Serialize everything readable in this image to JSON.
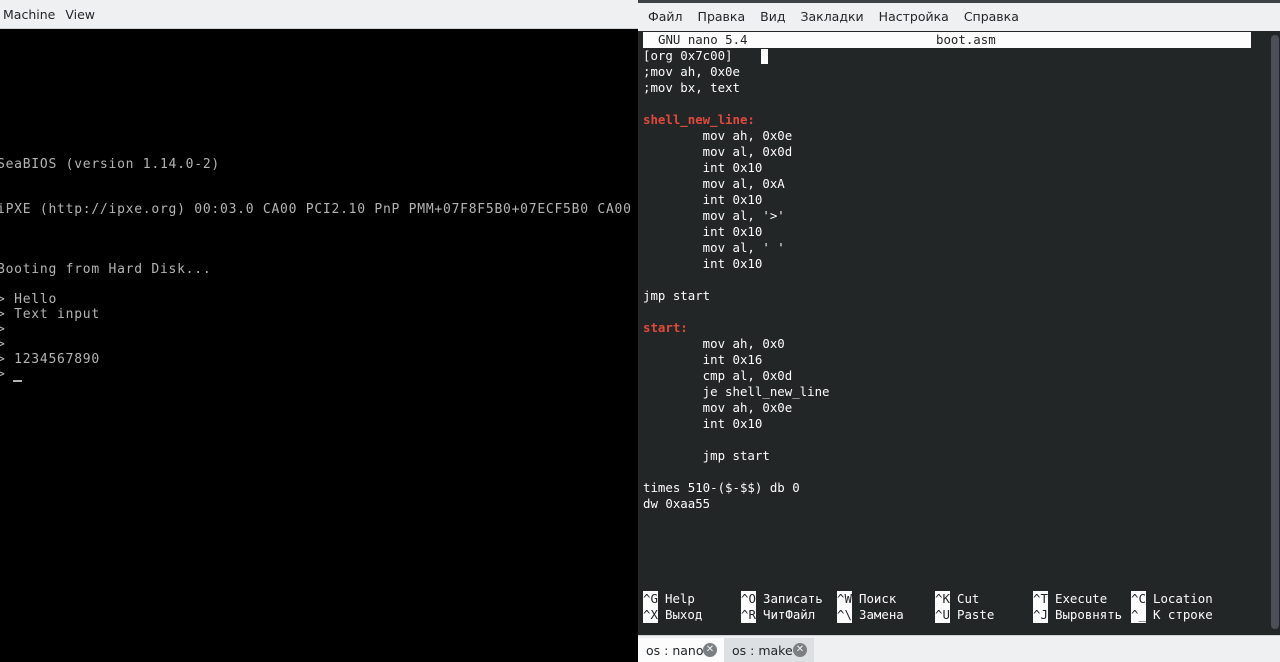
{
  "qemu": {
    "menu": [
      "Machine",
      "View"
    ],
    "screen_lines": [
      "SeaBIOS (version 1.14.0-2)",
      "iPXE (http://ipxe.org) 00:03.0 CA00 PCI2.10 PnP PMM+07F8F5B0+07ECF5B0 CA00",
      "Booting from Hard Disk...",
      "> Hello",
      "> Text input",
      ">",
      ">",
      "> 1234567890",
      ">"
    ]
  },
  "konsole": {
    "menu": [
      "Файл",
      "Правка",
      "Вид",
      "Закладки",
      "Настройка",
      "Справка"
    ],
    "nano": {
      "version": "GNU nano 5.4",
      "filename": "boot.asm",
      "lines": [
        {
          "text": "[org 0x7c00]",
          "label": false
        },
        {
          "text": ";mov ah, 0x0e",
          "label": false
        },
        {
          "text": ";mov bx, text",
          "label": false
        },
        {
          "text": "",
          "label": false
        },
        {
          "text": "shell_new_line:",
          "label": true
        },
        {
          "text": "        mov ah, 0x0e",
          "label": false
        },
        {
          "text": "        mov al, 0x0d",
          "label": false
        },
        {
          "text": "        int 0x10",
          "label": false
        },
        {
          "text": "        mov al, 0xA",
          "label": false
        },
        {
          "text": "        int 0x10",
          "label": false
        },
        {
          "text": "        mov al, '>'",
          "label": false
        },
        {
          "text": "        int 0x10",
          "label": false
        },
        {
          "text": "        mov al, ' '",
          "label": false
        },
        {
          "text": "        int 0x10",
          "label": false
        },
        {
          "text": "",
          "label": false
        },
        {
          "text": "jmp start",
          "label": false
        },
        {
          "text": "",
          "label": false
        },
        {
          "text": "start:",
          "label": true
        },
        {
          "text": "        mov ah, 0x0",
          "label": false
        },
        {
          "text": "        int 0x16",
          "label": false
        },
        {
          "text": "        cmp al, 0x0d",
          "label": false
        },
        {
          "text": "        je shell_new_line",
          "label": false
        },
        {
          "text": "        mov ah, 0x0e",
          "label": false
        },
        {
          "text": "        int 0x10",
          "label": false
        },
        {
          "text": "",
          "label": false
        },
        {
          "text": "        jmp start",
          "label": false
        },
        {
          "text": "",
          "label": false
        },
        {
          "text": "times 510-($-$$) db 0",
          "label": false
        },
        {
          "text": "dw 0xaa55",
          "label": false
        }
      ],
      "shortcuts_row1": [
        {
          "key": "^G",
          "label": "Help"
        },
        {
          "key": "^O",
          "label": "Записать"
        },
        {
          "key": "^W",
          "label": "Поиск"
        },
        {
          "key": "^K",
          "label": "Cut"
        },
        {
          "key": "^T",
          "label": "Execute"
        },
        {
          "key": "^C",
          "label": "Location"
        }
      ],
      "shortcuts_row2": [
        {
          "key": "^X",
          "label": "Выход"
        },
        {
          "key": "^R",
          "label": "ЧитФайл"
        },
        {
          "key": "^\\",
          "label": "Замена"
        },
        {
          "key": "^U",
          "label": "Paste"
        },
        {
          "key": "^J",
          "label": "Выровнять"
        },
        {
          "key": "^_",
          "label": "К строке"
        }
      ]
    },
    "tabs": [
      {
        "label": "os : nano",
        "active": true
      },
      {
        "label": "os : make",
        "active": false
      }
    ]
  },
  "colors": {
    "terminal_bg": "#232627",
    "terminal_fg": "#fcfcfc",
    "label_red": "#e04a3c",
    "vga_text": "#b4b4b4"
  }
}
